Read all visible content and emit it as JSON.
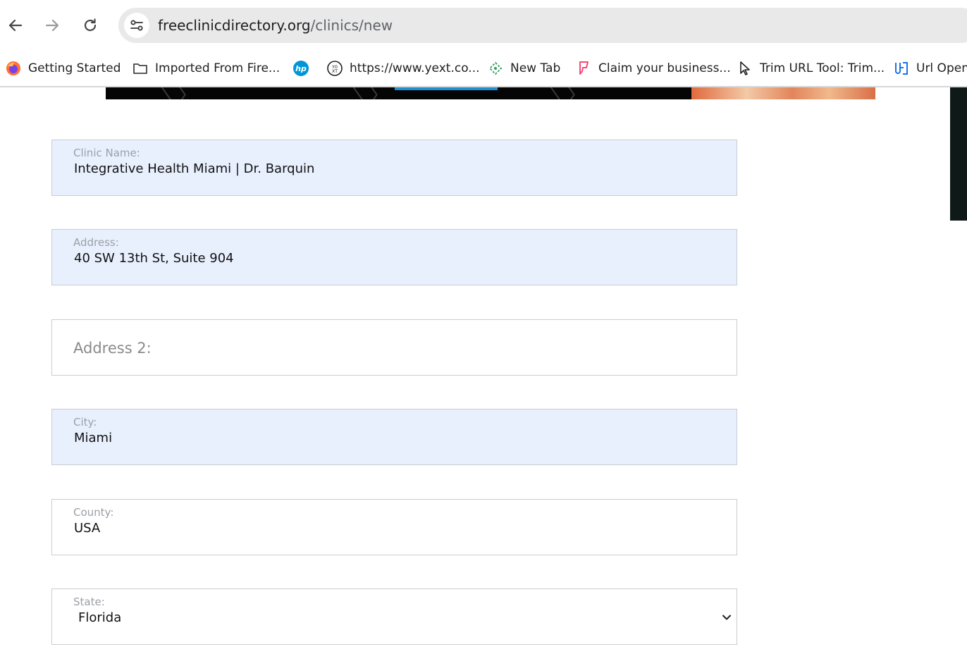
{
  "browser": {
    "url_host": "freeclinicdirectory.org",
    "url_path": "/clinics/new",
    "bookmarks": [
      {
        "label": "Getting Started",
        "icon": "firefox-icon"
      },
      {
        "label": "Imported From Fire...",
        "icon": "folder-icon"
      },
      {
        "label": "",
        "icon": "hp-icon"
      },
      {
        "label": "https://www.yext.co...",
        "icon": "yext-icon"
      },
      {
        "label": "New Tab",
        "icon": "new-tab-icon"
      },
      {
        "label": "Claim your business...",
        "icon": "foursquare-icon"
      },
      {
        "label": "Trim URL Tool: Trim...",
        "icon": "cursor-icon"
      },
      {
        "label": "Url Open",
        "icon": "url-open-icon"
      }
    ]
  },
  "form": {
    "clinic_name": {
      "label": "Clinic Name:",
      "value": "Integrative Health Miami | Dr. Barquin"
    },
    "address": {
      "label": "Address:",
      "value": "40 SW 13th St, Suite 904"
    },
    "address2": {
      "placeholder": "Address 2:"
    },
    "city": {
      "label": "City:",
      "value": "Miami"
    },
    "county": {
      "label": "County:",
      "value": "USA"
    },
    "state": {
      "label": "State:",
      "value": "Florida"
    }
  },
  "colors": {
    "autofill_bg": "#e8f0fe",
    "omnibox_bg": "#e9e9e9"
  }
}
